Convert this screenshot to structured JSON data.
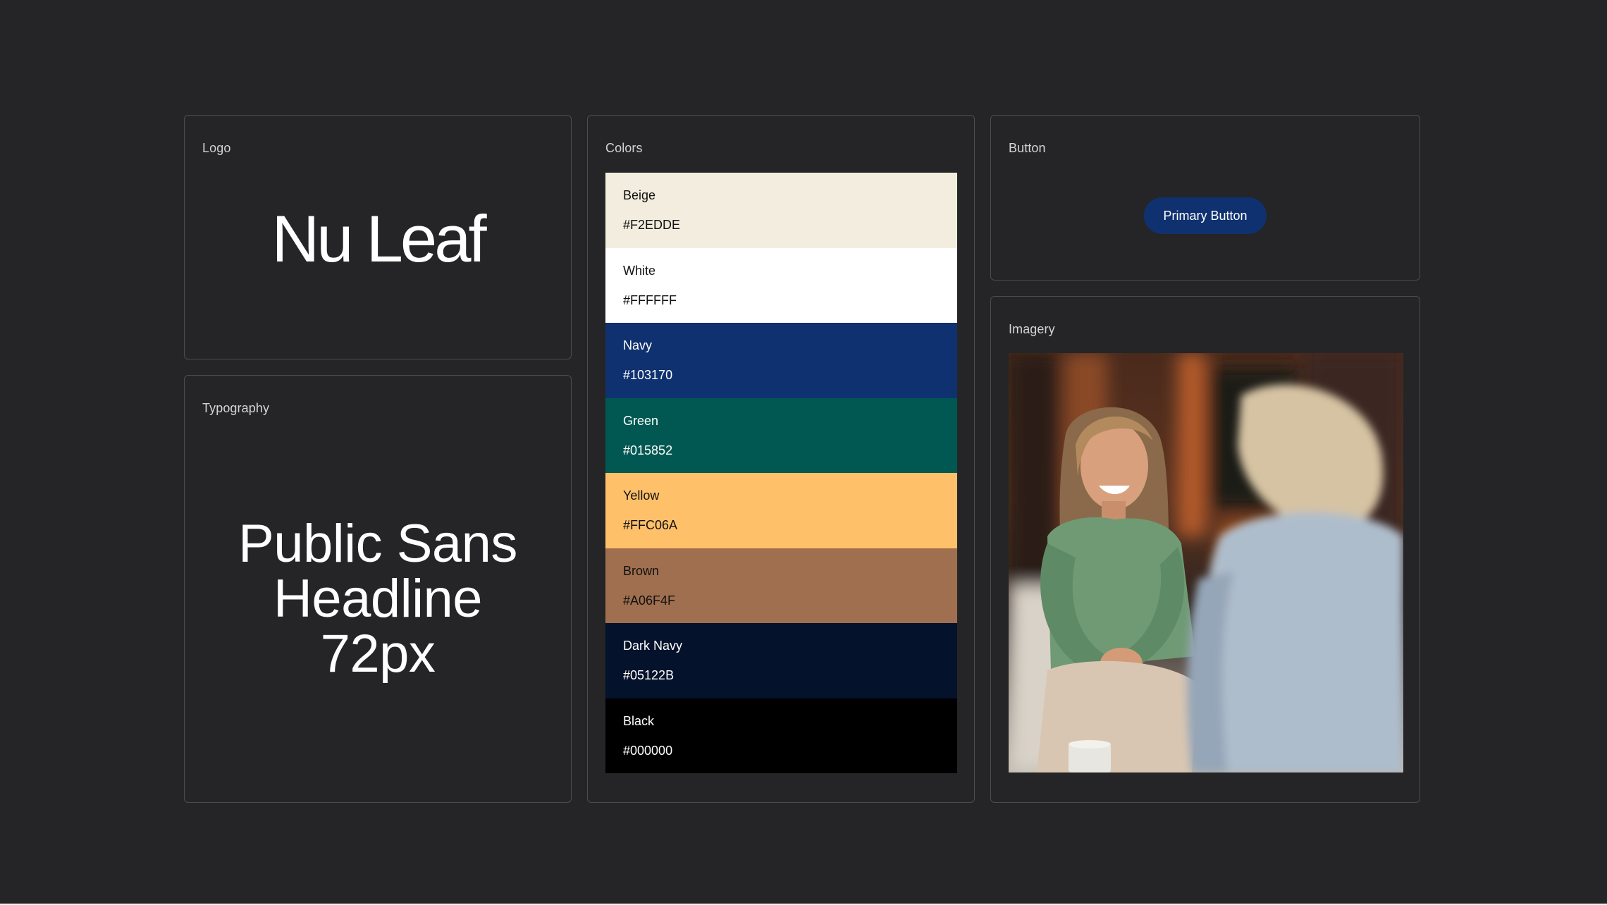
{
  "logo": {
    "label": "Logo",
    "wordmark": "Nu Leaf"
  },
  "typography": {
    "label": "Typography",
    "sample_lines": [
      "Public Sans",
      "Headline",
      "72px"
    ]
  },
  "colors": {
    "label": "Colors",
    "swatches": [
      {
        "name": "Beige",
        "hex": "#F2EDDE",
        "bg": "#F2EDDE",
        "text_color": "#111111"
      },
      {
        "name": "White",
        "hex": "#FFFFFF",
        "bg": "#FFFFFF",
        "text_color": "#111111"
      },
      {
        "name": "Navy",
        "hex": "#103170",
        "bg": "#103170",
        "text_color": "#FFFFFF"
      },
      {
        "name": "Green",
        "hex": "#015852",
        "bg": "#015852",
        "text_color": "#FFFFFF"
      },
      {
        "name": "Yellow",
        "hex": "#FFC06A",
        "bg": "#FFC06A",
        "text_color": "#111111"
      },
      {
        "name": "Brown",
        "hex": "#A06F4F",
        "bg": "#A06F4F",
        "text_color": "#111111"
      },
      {
        "name": "Dark Navy",
        "hex": "#05122B",
        "bg": "#05122B",
        "text_color": "#FFFFFF"
      },
      {
        "name": "Black",
        "hex": "#000000",
        "bg": "#000000",
        "text_color": "#FFFFFF"
      }
    ]
  },
  "button": {
    "label": "Button",
    "primary_label": "Primary Button",
    "primary_color": "#103170"
  },
  "imagery": {
    "label": "Imagery"
  }
}
